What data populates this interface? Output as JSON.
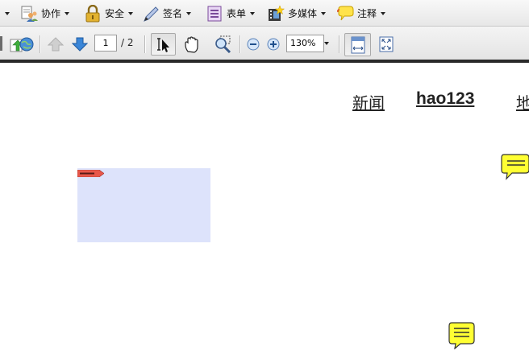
{
  "menu": {
    "items": [
      {
        "label": "协作",
        "icon": "collaborate-icon"
      },
      {
        "label": "安全",
        "icon": "lock-icon"
      },
      {
        "label": "签名",
        "icon": "pen-icon"
      },
      {
        "label": "表单",
        "icon": "form-icon"
      },
      {
        "label": "多媒体",
        "icon": "film-icon"
      },
      {
        "label": "注释",
        "icon": "comment-icon"
      }
    ]
  },
  "nav": {
    "current_page": "1",
    "total_pages": "/ 2",
    "zoom": "130%"
  },
  "document": {
    "links": [
      "新闻",
      "hao123",
      "地"
    ]
  },
  "colors": {
    "form_field": "#dde3fb",
    "note": "#ffff33",
    "accent": "#3a7bd5"
  }
}
